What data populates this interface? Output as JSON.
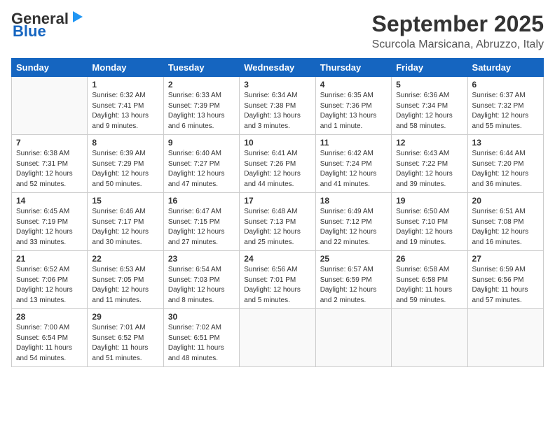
{
  "logo": {
    "line1": "General",
    "line2": "Blue"
  },
  "title": "September 2025",
  "location": "Scurcola Marsicana, Abruzzo, Italy",
  "days_of_week": [
    "Sunday",
    "Monday",
    "Tuesday",
    "Wednesday",
    "Thursday",
    "Friday",
    "Saturday"
  ],
  "weeks": [
    [
      {
        "day": "",
        "info": ""
      },
      {
        "day": "1",
        "info": "Sunrise: 6:32 AM\nSunset: 7:41 PM\nDaylight: 13 hours\nand 9 minutes."
      },
      {
        "day": "2",
        "info": "Sunrise: 6:33 AM\nSunset: 7:39 PM\nDaylight: 13 hours\nand 6 minutes."
      },
      {
        "day": "3",
        "info": "Sunrise: 6:34 AM\nSunset: 7:38 PM\nDaylight: 13 hours\nand 3 minutes."
      },
      {
        "day": "4",
        "info": "Sunrise: 6:35 AM\nSunset: 7:36 PM\nDaylight: 13 hours\nand 1 minute."
      },
      {
        "day": "5",
        "info": "Sunrise: 6:36 AM\nSunset: 7:34 PM\nDaylight: 12 hours\nand 58 minutes."
      },
      {
        "day": "6",
        "info": "Sunrise: 6:37 AM\nSunset: 7:32 PM\nDaylight: 12 hours\nand 55 minutes."
      }
    ],
    [
      {
        "day": "7",
        "info": "Sunrise: 6:38 AM\nSunset: 7:31 PM\nDaylight: 12 hours\nand 52 minutes."
      },
      {
        "day": "8",
        "info": "Sunrise: 6:39 AM\nSunset: 7:29 PM\nDaylight: 12 hours\nand 50 minutes."
      },
      {
        "day": "9",
        "info": "Sunrise: 6:40 AM\nSunset: 7:27 PM\nDaylight: 12 hours\nand 47 minutes."
      },
      {
        "day": "10",
        "info": "Sunrise: 6:41 AM\nSunset: 7:26 PM\nDaylight: 12 hours\nand 44 minutes."
      },
      {
        "day": "11",
        "info": "Sunrise: 6:42 AM\nSunset: 7:24 PM\nDaylight: 12 hours\nand 41 minutes."
      },
      {
        "day": "12",
        "info": "Sunrise: 6:43 AM\nSunset: 7:22 PM\nDaylight: 12 hours\nand 39 minutes."
      },
      {
        "day": "13",
        "info": "Sunrise: 6:44 AM\nSunset: 7:20 PM\nDaylight: 12 hours\nand 36 minutes."
      }
    ],
    [
      {
        "day": "14",
        "info": "Sunrise: 6:45 AM\nSunset: 7:19 PM\nDaylight: 12 hours\nand 33 minutes."
      },
      {
        "day": "15",
        "info": "Sunrise: 6:46 AM\nSunset: 7:17 PM\nDaylight: 12 hours\nand 30 minutes."
      },
      {
        "day": "16",
        "info": "Sunrise: 6:47 AM\nSunset: 7:15 PM\nDaylight: 12 hours\nand 27 minutes."
      },
      {
        "day": "17",
        "info": "Sunrise: 6:48 AM\nSunset: 7:13 PM\nDaylight: 12 hours\nand 25 minutes."
      },
      {
        "day": "18",
        "info": "Sunrise: 6:49 AM\nSunset: 7:12 PM\nDaylight: 12 hours\nand 22 minutes."
      },
      {
        "day": "19",
        "info": "Sunrise: 6:50 AM\nSunset: 7:10 PM\nDaylight: 12 hours\nand 19 minutes."
      },
      {
        "day": "20",
        "info": "Sunrise: 6:51 AM\nSunset: 7:08 PM\nDaylight: 12 hours\nand 16 minutes."
      }
    ],
    [
      {
        "day": "21",
        "info": "Sunrise: 6:52 AM\nSunset: 7:06 PM\nDaylight: 12 hours\nand 13 minutes."
      },
      {
        "day": "22",
        "info": "Sunrise: 6:53 AM\nSunset: 7:05 PM\nDaylight: 12 hours\nand 11 minutes."
      },
      {
        "day": "23",
        "info": "Sunrise: 6:54 AM\nSunset: 7:03 PM\nDaylight: 12 hours\nand 8 minutes."
      },
      {
        "day": "24",
        "info": "Sunrise: 6:56 AM\nSunset: 7:01 PM\nDaylight: 12 hours\nand 5 minutes."
      },
      {
        "day": "25",
        "info": "Sunrise: 6:57 AM\nSunset: 6:59 PM\nDaylight: 12 hours\nand 2 minutes."
      },
      {
        "day": "26",
        "info": "Sunrise: 6:58 AM\nSunset: 6:58 PM\nDaylight: 11 hours\nand 59 minutes."
      },
      {
        "day": "27",
        "info": "Sunrise: 6:59 AM\nSunset: 6:56 PM\nDaylight: 11 hours\nand 57 minutes."
      }
    ],
    [
      {
        "day": "28",
        "info": "Sunrise: 7:00 AM\nSunset: 6:54 PM\nDaylight: 11 hours\nand 54 minutes."
      },
      {
        "day": "29",
        "info": "Sunrise: 7:01 AM\nSunset: 6:52 PM\nDaylight: 11 hours\nand 51 minutes."
      },
      {
        "day": "30",
        "info": "Sunrise: 7:02 AM\nSunset: 6:51 PM\nDaylight: 11 hours\nand 48 minutes."
      },
      {
        "day": "",
        "info": ""
      },
      {
        "day": "",
        "info": ""
      },
      {
        "day": "",
        "info": ""
      },
      {
        "day": "",
        "info": ""
      }
    ]
  ]
}
